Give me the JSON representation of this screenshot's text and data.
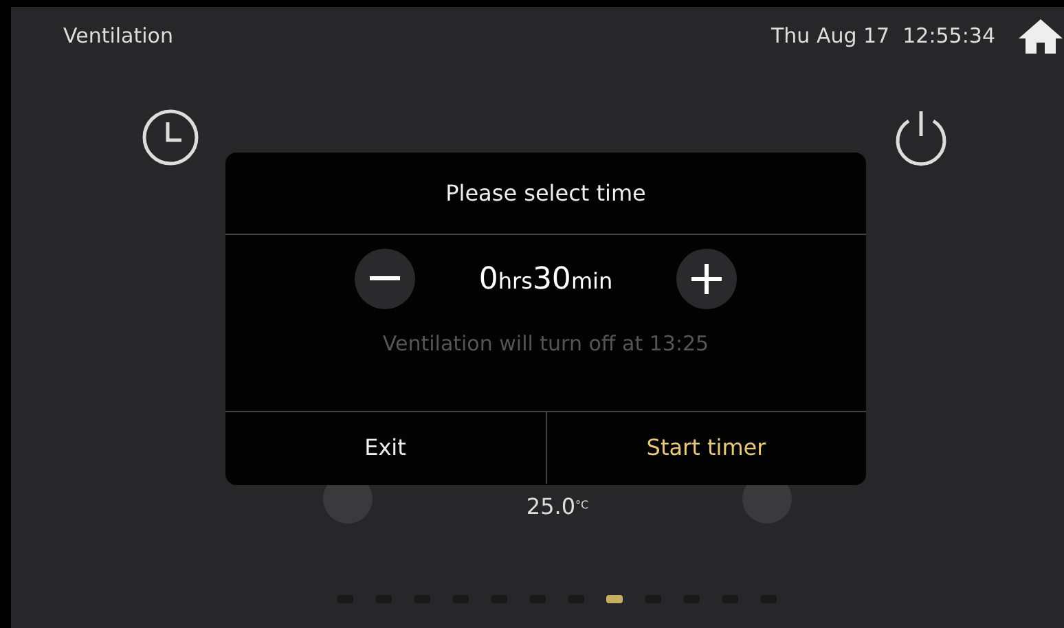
{
  "header": {
    "title": "Ventilation",
    "date": "Thu Aug 17",
    "time": "12:55:34"
  },
  "temperature": {
    "value": "25.0",
    "unit": "°C"
  },
  "dialog": {
    "title": "Please select time",
    "hours": "0",
    "hours_unit": "hrs",
    "minutes": "30",
    "minutes_unit": "min",
    "message": "Ventilation will turn off at 13:25",
    "buttons": [
      {
        "label": "Exit",
        "kind": "plain"
      },
      {
        "label": "Start timer",
        "kind": "primary"
      }
    ]
  },
  "pages": [
    {
      "selected": false
    },
    {
      "selected": false
    },
    {
      "selected": false
    },
    {
      "selected": false
    },
    {
      "selected": false
    },
    {
      "selected": false
    },
    {
      "selected": false
    },
    {
      "selected": true
    },
    {
      "selected": false
    },
    {
      "selected": false
    },
    {
      "selected": false
    },
    {
      "selected": false
    }
  ]
}
